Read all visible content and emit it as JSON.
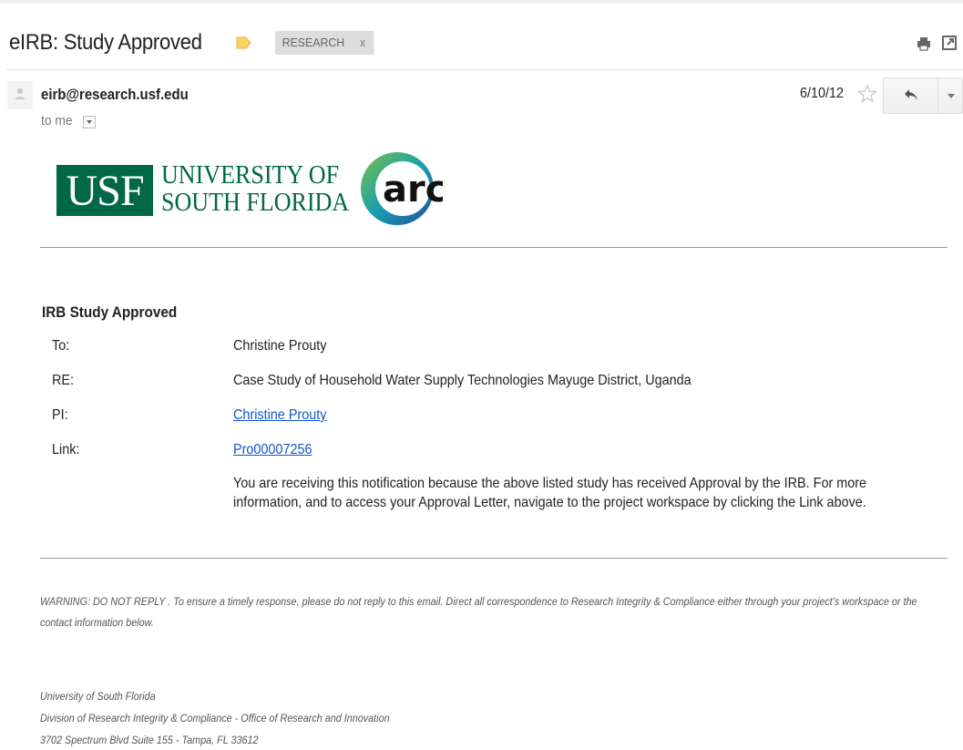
{
  "header": {
    "subject": "eIRB: Study Approved",
    "label_chip": "RESEARCH",
    "label_chip_remove": "x"
  },
  "sender": {
    "email": "eirb@research.usf.edu",
    "recipient": "to me",
    "date": "6/10/12"
  },
  "logos": {
    "usf_mark": "USF",
    "usf_name_line1": "UNIVERSITY OF",
    "usf_name_line2": "SOUTH FLORIDA",
    "arc_mark": "arc"
  },
  "message": {
    "heading": "IRB Study Approved",
    "fields": [
      {
        "label": "To:",
        "value": "Christine Prouty"
      },
      {
        "label": "RE:",
        "value": "Case Study of Household Water Supply Technologies Mayuge District, Uganda"
      },
      {
        "label": "PI:",
        "value": "Christine Prouty"
      },
      {
        "label": "Link:",
        "value": "Pro00007256"
      }
    ],
    "notice": "You are receiving this notification because the above listed study has received Approval by the IRB.  For more information, and to access your Approval Letter, navigate to the project workspace by clicking the Link above."
  },
  "warning": "WARNING: DO NOT REPLY . To ensure a timely response, please do not reply to this email.  Direct all correspondence to Research Integrity & Compliance either through your project's workspace or the contact information below.",
  "footer": {
    "line1": "University of South Florida",
    "line2": "Division of Research Integrity & Compliance - Office of Research and Innovation",
    "line3": "3702 Spectrum Blvd Suite 155 - Tampa, FL 33612"
  },
  "colors": {
    "usf_green": "#006747",
    "link": "#1155cc",
    "label_tag": "#fad165"
  },
  "icons": [
    "label-tag-icon",
    "print-icon",
    "new-window-icon",
    "avatar-icon",
    "star-icon",
    "reply-icon",
    "dropdown-arrow-icon"
  ]
}
